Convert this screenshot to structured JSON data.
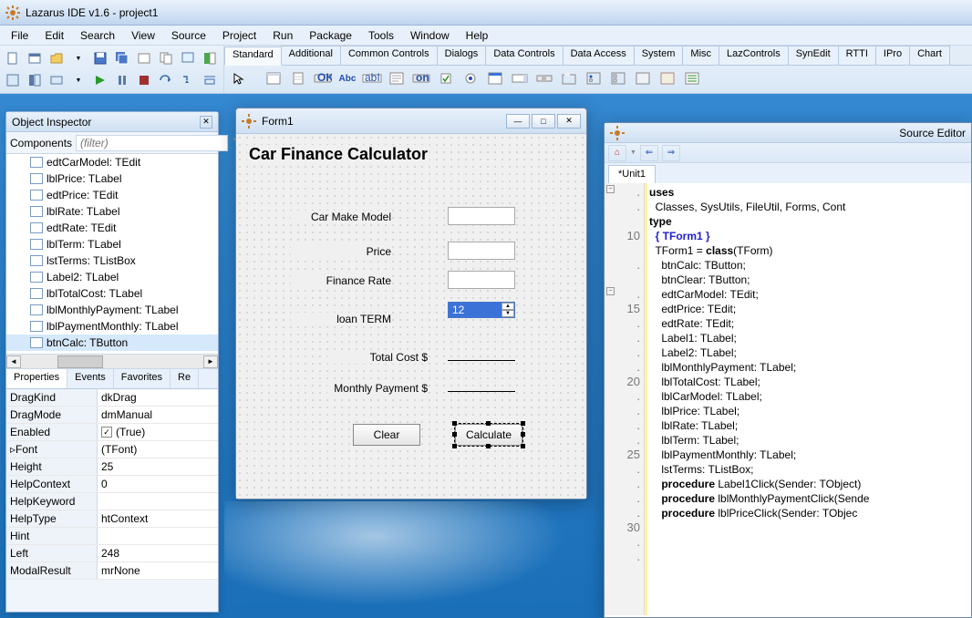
{
  "title": "Lazarus IDE v1.6 - project1",
  "menu": [
    "File",
    "Edit",
    "Search",
    "View",
    "Source",
    "Project",
    "Run",
    "Package",
    "Tools",
    "Window",
    "Help"
  ],
  "componentTabs": [
    "Standard",
    "Additional",
    "Common Controls",
    "Dialogs",
    "Data Controls",
    "Data Access",
    "System",
    "Misc",
    "LazControls",
    "SynEdit",
    "RTTI",
    "IPro",
    "Chart"
  ],
  "objInspector": {
    "title": "Object Inspector",
    "componentsLabel": "Components",
    "filterPlaceholder": "(filter)",
    "tree": [
      "edtCarModel: TEdit",
      "lblPrice: TLabel",
      "edtPrice: TEdit",
      "lblRate: TLabel",
      "edtRate: TEdit",
      "lblTerm: TLabel",
      "lstTerms: TListBox",
      "Label2: TLabel",
      "lblTotalCost: TLabel",
      "lblMonthlyPayment: TLabel",
      "lblPaymentMonthly: TLabel",
      "btnCalc: TButton"
    ],
    "propTabs": [
      "Properties",
      "Events",
      "Favorites",
      "Re"
    ],
    "props": [
      {
        "n": "DragKind",
        "v": "dkDrag"
      },
      {
        "n": "DragMode",
        "v": "dmManual"
      },
      {
        "n": "Enabled",
        "v": "(True)",
        "chk": true
      },
      {
        "n": "Font",
        "v": "(TFont)",
        "expand": true
      },
      {
        "n": "Height",
        "v": "25"
      },
      {
        "n": "HelpContext",
        "v": "0"
      },
      {
        "n": "HelpKeyword",
        "v": ""
      },
      {
        "n": "HelpType",
        "v": "htContext"
      },
      {
        "n": "Hint",
        "v": ""
      },
      {
        "n": "Left",
        "v": "248"
      },
      {
        "n": "ModalResult",
        "v": "mrNone"
      }
    ]
  },
  "form": {
    "title": "Form1",
    "heading": "Car Finance Calculator",
    "labels": {
      "carModel": "Car Make Model",
      "price": "Price",
      "rate": "Finance Rate",
      "term": "loan TERM",
      "total": "Total Cost  $",
      "monthly": "Monthly Payment $"
    },
    "listValue": "12",
    "btnClear": "Clear",
    "btnCalc": "Calculate"
  },
  "sourceEditor": {
    "title": "Source Editor",
    "tab": "*Unit1",
    "lines": [
      {
        "g": ".",
        "t": "uses",
        "cls": "kw",
        "fold": "-"
      },
      {
        "g": ".",
        "t": "  Classes, SysUtils, FileUtil, Forms, Cont"
      },
      {
        "g": "",
        "t": ""
      },
      {
        "g": "10",
        "t": "type",
        "cls": "kw"
      },
      {
        "g": "",
        "t": ""
      },
      {
        "g": ".",
        "t": "  { TForm1 }",
        "cls": "cm"
      },
      {
        "g": "",
        "t": ""
      },
      {
        "g": ".",
        "t": "  TForm1 = class(TForm)",
        "kwparts": [
          "class"
        ],
        "fold": "-"
      },
      {
        "g": "15",
        "t": "    btnCalc: TButton;"
      },
      {
        "g": ".",
        "t": "    btnClear: TButton;"
      },
      {
        "g": ".",
        "t": "    edtCarModel: TEdit;"
      },
      {
        "g": ".",
        "t": "    edtPrice: TEdit;"
      },
      {
        "g": ".",
        "t": "    edtRate: TEdit;"
      },
      {
        "g": "20",
        "t": "    Label1: TLabel;"
      },
      {
        "g": ".",
        "t": "    Label2: TLabel;"
      },
      {
        "g": ".",
        "t": "    lblMonthlyPayment: TLabel;"
      },
      {
        "g": ".",
        "t": "    lblTotalCost: TLabel;"
      },
      {
        "g": ".",
        "t": "    lblCarModel: TLabel;"
      },
      {
        "g": "25",
        "t": "    lblPrice: TLabel;"
      },
      {
        "g": ".",
        "t": "    lblRate: TLabel;"
      },
      {
        "g": ".",
        "t": "    lblTerm: TLabel;"
      },
      {
        "g": ".",
        "t": "    lblPaymentMonthly: TLabel;"
      },
      {
        "g": ".",
        "t": "    lstTerms: TListBox;"
      },
      {
        "g": "30",
        "t": "    procedure Label1Click(Sender: TObject)",
        "kwparts": [
          "procedure"
        ]
      },
      {
        "g": ".",
        "t": "    procedure lblMonthlyPaymentClick(Sende",
        "kwparts": [
          "procedure"
        ]
      },
      {
        "g": ".",
        "t": "    procedure lblPriceClick(Sender: TObjec",
        "kwparts": [
          "procedure"
        ]
      }
    ]
  }
}
